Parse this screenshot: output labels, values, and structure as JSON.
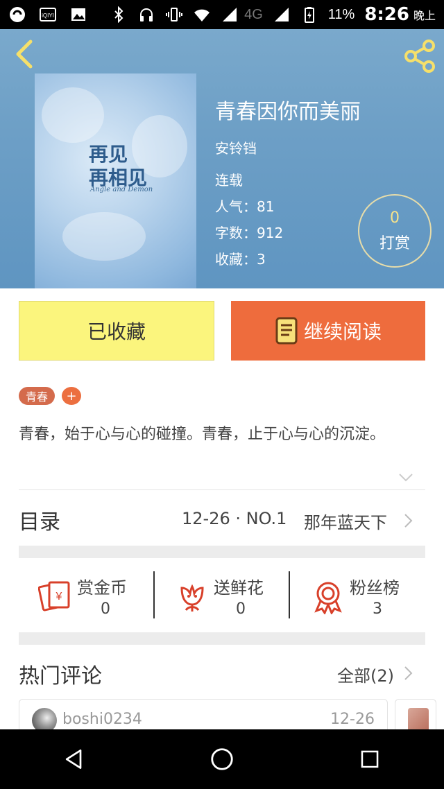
{
  "status_bar": {
    "signal_label": "4G",
    "battery_percent": "11%",
    "time": "8:26",
    "period": "晚上",
    "icons": [
      "app-icon",
      "iqiyi-icon",
      "image-icon",
      "bluetooth-icon",
      "headphones-icon",
      "vibrate-icon",
      "wifi-icon",
      "signal-icon",
      "battery-icon"
    ],
    "iqiyi_text": "iQIYI"
  },
  "book": {
    "title": "青春因你而美丽",
    "author": "安铃铛",
    "status": "连载",
    "popularity": "人气：81",
    "word_count": "字数：912",
    "favorites": "收藏：3",
    "cover_title_line1": "再见",
    "cover_title_line2": "再相见",
    "cover_subtitle": "Angle and Demon"
  },
  "reward": {
    "count": "0",
    "label": "打赏"
  },
  "actions": {
    "saved_label": "已收藏",
    "read_label": "继续阅读"
  },
  "tags": {
    "items": [
      "青春"
    ],
    "add_label": "+"
  },
  "synopsis": "青春，始于心与心的碰撞。青春，止于心与心的沉淀。",
  "toc": {
    "label": "目录",
    "latest_date": "12-26 · NO.1",
    "latest_chapter": "那年蓝天下"
  },
  "stats": [
    {
      "label": "赏金币",
      "value": "0",
      "icon": "coin-icon"
    },
    {
      "label": "送鲜花",
      "value": "0",
      "icon": "flower-icon"
    },
    {
      "label": "粉丝榜",
      "value": "3",
      "icon": "badge-icon"
    }
  ],
  "comments": {
    "title": "热门评论",
    "all_label": "全部(2)",
    "items": [
      {
        "user": "boshi0234",
        "date": "12-26"
      }
    ]
  },
  "colors": {
    "accent_orange": "#ee6c3d",
    "saved_yellow": "#fbf57d",
    "hero_blue": "#6d9fc6",
    "icon_red": "#d8402a"
  }
}
